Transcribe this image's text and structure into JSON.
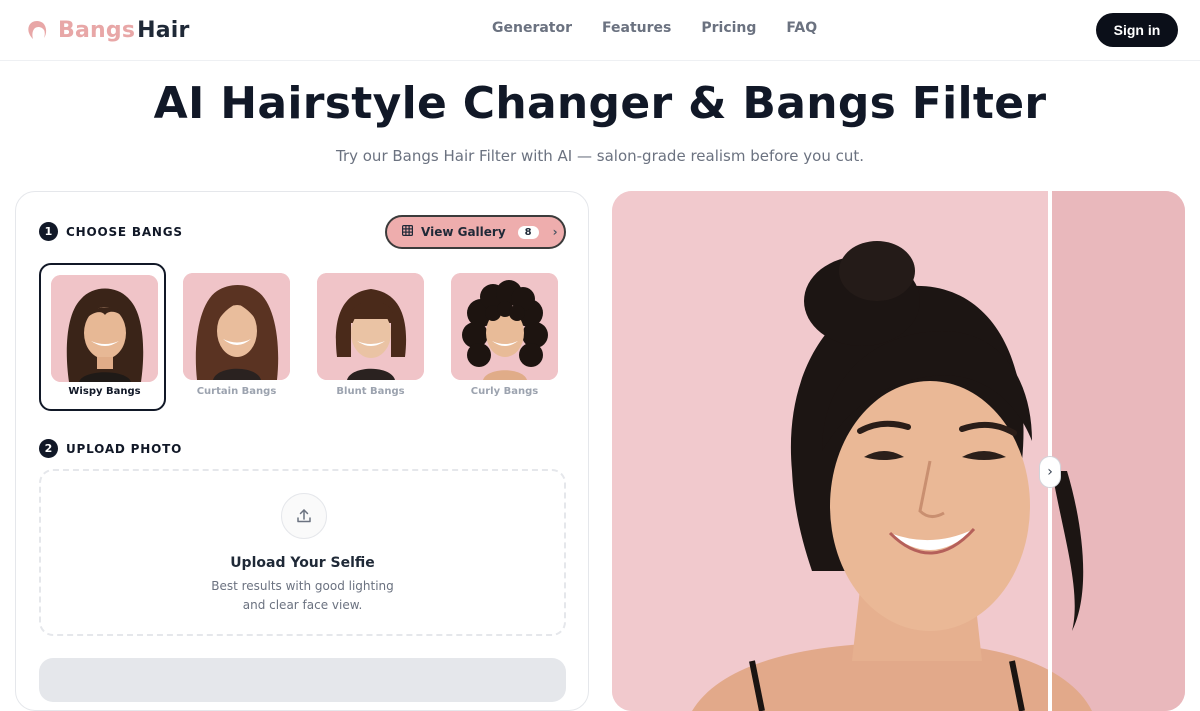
{
  "brand": {
    "part1": "Bangs",
    "part2": "Hair",
    "accent": "#e8a7a7"
  },
  "nav": {
    "items": [
      "Generator",
      "Features",
      "Pricing",
      "FAQ"
    ],
    "signin": "Sign in"
  },
  "hero": {
    "title": "AI Hairstyle Changer & Bangs Filter",
    "subtitle": "Try our Bangs Hair Filter with AI — salon-grade realism before you cut."
  },
  "step1": {
    "num": "1",
    "label": "CHOOSE BANGS"
  },
  "gallery": {
    "label": "View Gallery",
    "count": "8",
    "icon": "grid-icon"
  },
  "styles": [
    {
      "label": "Wispy Bangs",
      "selected": true
    },
    {
      "label": "Curtain Bangs",
      "selected": false
    },
    {
      "label": "Blunt Bangs",
      "selected": false
    },
    {
      "label": "Curly Bangs",
      "selected": false
    }
  ],
  "step2": {
    "num": "2",
    "label": "UPLOAD PHOTO"
  },
  "upload": {
    "title": "Upload Your Selfie",
    "desc1": "Best results with good lighting",
    "desc2": "and clear face view.",
    "icon": "upload-icon"
  },
  "preview": {
    "handle_icon": "chevron-right-icon"
  }
}
